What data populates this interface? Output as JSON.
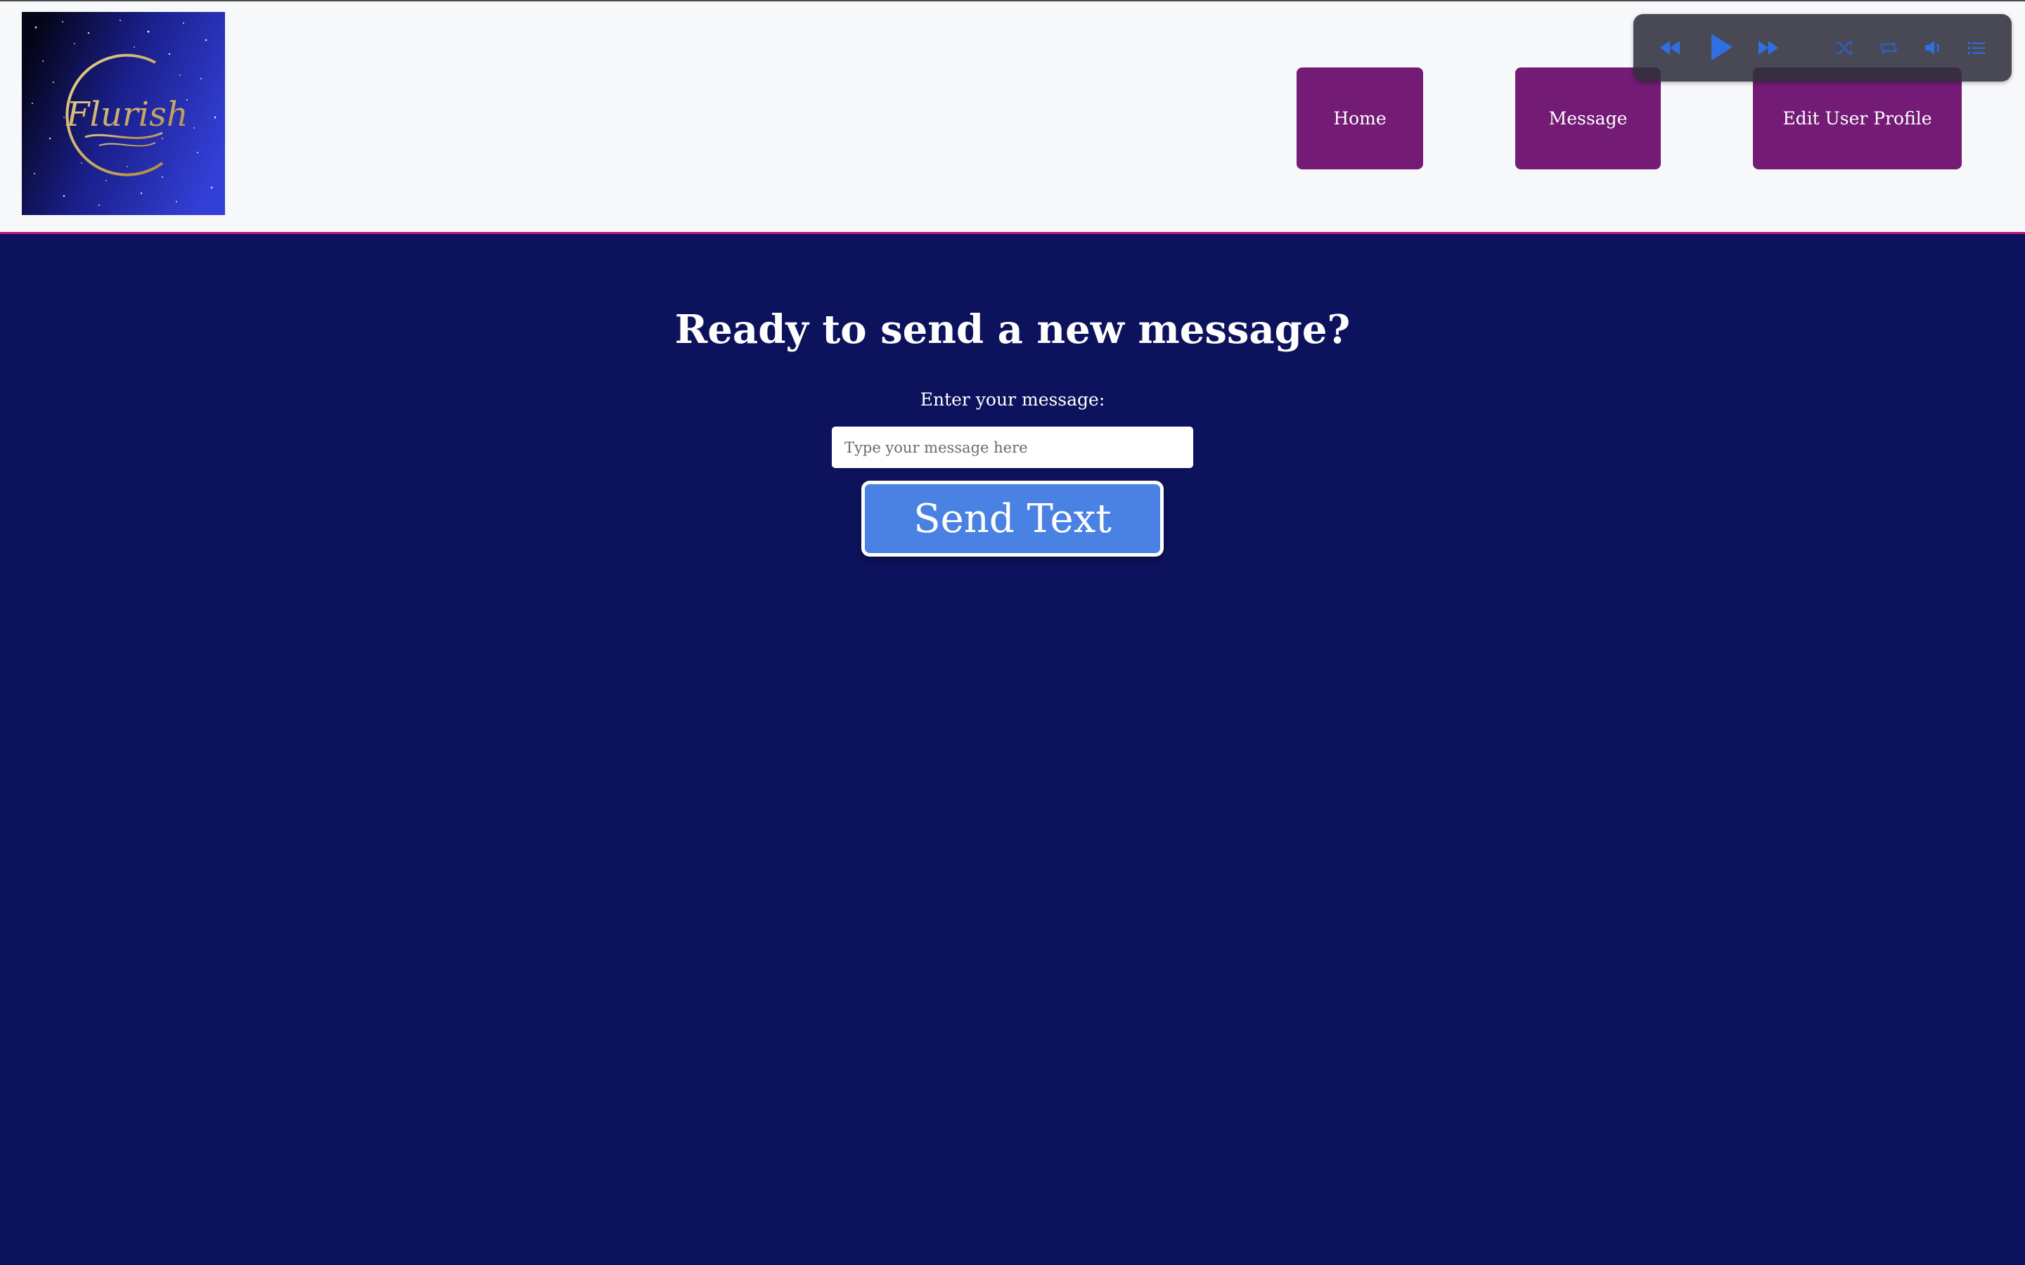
{
  "header": {
    "logo_text": "Flurish",
    "nav": {
      "home": "Home",
      "message": "Message",
      "edit_profile": "Edit User Profile"
    }
  },
  "player": {
    "controls": [
      "rewind-icon",
      "play-icon",
      "fast-forward-icon",
      "shuffle-icon",
      "repeat-icon",
      "volume-icon",
      "playlist-icon"
    ],
    "accent": "#2f6fe4"
  },
  "main": {
    "title": "Ready to send a new message?",
    "input_label": "Enter your message:",
    "input_placeholder": "Type your message here",
    "input_value": "",
    "send_label": "Send Text"
  },
  "colors": {
    "background": "#0c135c",
    "header_bg": "#f7f8fa",
    "nav_button": "#731b75",
    "send_button": "#4a82e3",
    "header_border": "#c2187a"
  }
}
